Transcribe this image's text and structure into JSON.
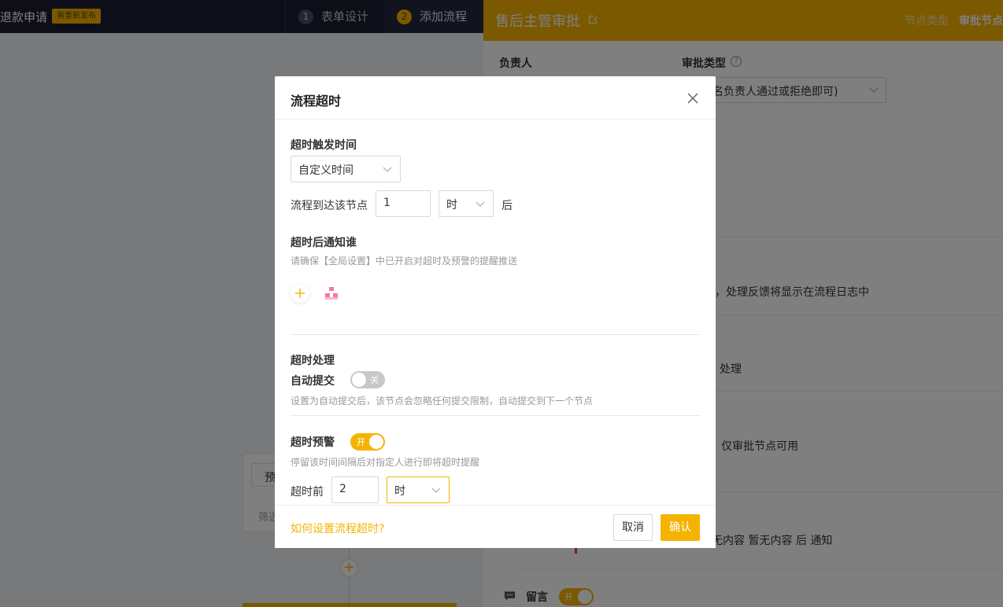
{
  "header": {
    "app_title": "退款申请",
    "badge": "需重新发布",
    "steps": [
      {
        "num": "1",
        "label": "表单设计"
      },
      {
        "num": "2",
        "label": "添加流程"
      }
    ]
  },
  "canvas": {
    "node_chip": "预",
    "node_sub": "筛选",
    "add_icon": "+"
  },
  "drawer": {
    "title": "售后主管审批",
    "tabs": [
      "节点类型",
      "审批节点"
    ],
    "owner_label": "负责人",
    "approve_type_label": "审批类型",
    "approve_type_value": "任一名负责人通过或拒绝即可)",
    "row_feedback": "填，处理反馈将显示在流程日志中",
    "row_handle": "处理",
    "row_only_approve": "仅审批节点可用",
    "row_notify": "无内容 暂无内容 后  通知",
    "comment_label": "留言",
    "comment_toggle": "开"
  },
  "modal": {
    "title": "流程超时",
    "trigger_title": "超时触发时间",
    "trigger_select": "自定义时间",
    "arrive_label": "流程到达该节点",
    "arrive_value": "1",
    "arrive_unit": "时",
    "arrive_suffix": "后",
    "notify_title": "超时后通知谁",
    "notify_hint": "请确保【全局设置】中已开启对超时及预警的提醒推送",
    "handle_title": "超时处理",
    "auto_submit_label": "自动提交",
    "auto_submit_toggle": "关",
    "auto_submit_hint": "设置为自动提交后，该节点会忽略任何提交限制，自动提交到下一个节点",
    "warn_title": "超时预警",
    "warn_toggle": "开",
    "warn_hint": "停留该时间间隔后对指定人进行即将超时提醒",
    "before_label": "超时前",
    "before_value": "2",
    "before_unit": "时",
    "help_link": "如何设置流程超时?",
    "cancel": "取消",
    "confirm": "确认"
  },
  "colors": {
    "accent": "#f5b301",
    "header_bg": "#1a1c30"
  }
}
